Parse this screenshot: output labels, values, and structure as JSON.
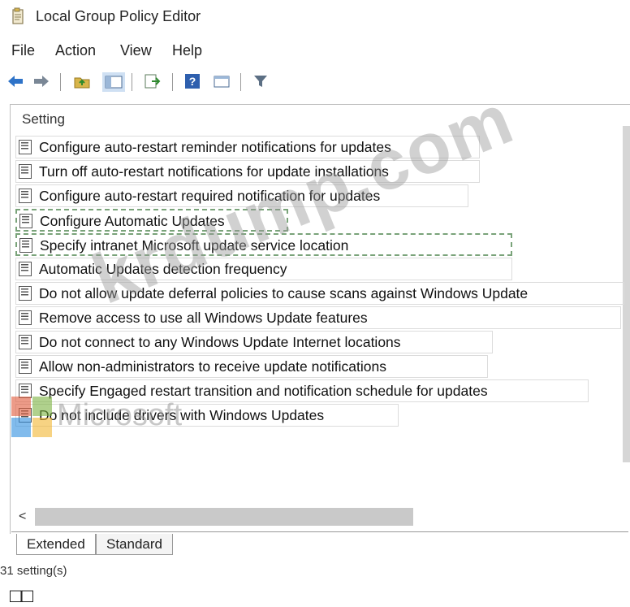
{
  "window": {
    "title": "Local Group Policy Editor",
    "icon": "gpedit-icon"
  },
  "menu": [
    {
      "label": "File"
    },
    {
      "label": "Action"
    },
    {
      "label": "View"
    },
    {
      "label": "Help"
    }
  ],
  "toolbar": {
    "icons": [
      "back-arrow-icon",
      "forward-arrow-icon",
      "up-folder-icon",
      "show-hide-tree-icon",
      "export-list-icon",
      "help-icon",
      "extended-view-icon",
      "filter-icon"
    ]
  },
  "list": {
    "column_header": "Setting",
    "items": [
      {
        "label": "Configure auto-restart reminder notifications for updates"
      },
      {
        "label": "Turn off auto-restart notifications for update installations"
      },
      {
        "label": "Configure auto-restart required notification for updates"
      },
      {
        "label": "Configure Automatic Updates"
      },
      {
        "label": "Specify intranet Microsoft update service location"
      },
      {
        "label": "Automatic Updates detection frequency"
      },
      {
        "label": "Do not allow update deferral policies to cause scans against Windows Update"
      },
      {
        "label": "Remove access to use all Windows Update features"
      },
      {
        "label": "Do not connect to any Windows Update Internet locations"
      },
      {
        "label": "Allow non-administrators to receive update notifications"
      },
      {
        "label": "Specify Engaged restart transition and notification schedule for updates"
      },
      {
        "label": "Do not include drivers with Windows Updates"
      }
    ]
  },
  "scroll": {
    "left_arrow": "<"
  },
  "tabs": [
    {
      "label": "Extended"
    },
    {
      "label": "Standard"
    }
  ],
  "status_text": "31 setting(s)",
  "bottom_glyphs": "□□",
  "watermark": {
    "site": "krdump.com",
    "brand": "Microsoft"
  },
  "colors": {
    "toolbar_blue": "#2e73c8",
    "folder_yellow": "#d8b54a",
    "filter_gray": "#5c6f84"
  }
}
